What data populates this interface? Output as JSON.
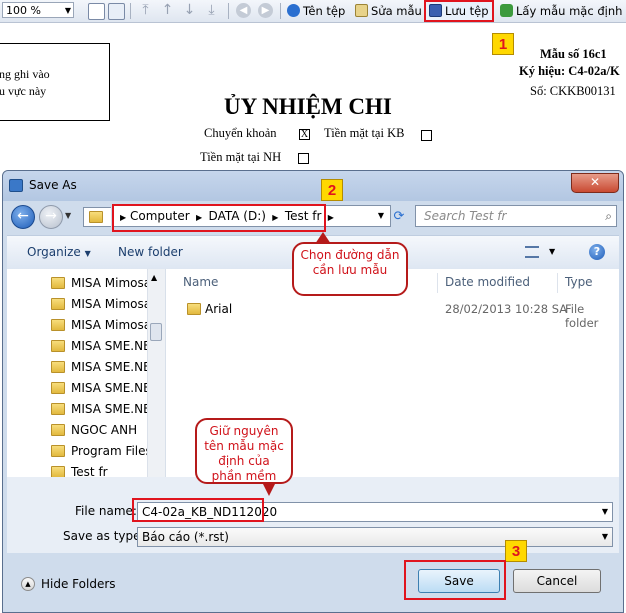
{
  "toolbar": {
    "zoom": "100 %",
    "ten_tep": "Tên tệp",
    "sua_mau": "Sửa mẫu",
    "luu_tep": "Lưu tệp",
    "lay_mau": "Lấy mẫu mặc định"
  },
  "steps": [
    "1",
    "2",
    "3"
  ],
  "document": {
    "box_line1": "ng ghi vào",
    "box_line2": "u vực này",
    "form_no": "Mẫu số 16c1",
    "code": "Ký hiệu: C4-02a/K",
    "number": "Số: CKKB00131",
    "title": "ỦY NHIỆM CHI",
    "chuyen_khoan": "Chuyển khoản",
    "chuyen_khoan_mark": "X",
    "tien_mat_kb": "Tiền mặt tại KB",
    "tien_mat_nh": "Tiền mặt tại NH"
  },
  "dialog": {
    "title": "Save As",
    "close": "✕",
    "breadcrumb": [
      "Computer",
      "DATA (D:)",
      "Test fr"
    ],
    "search_placeholder": "Search Test fr",
    "organize": "Organize",
    "new_folder": "New folder",
    "nav_items": [
      "MISA Mimosa",
      "MISA Mimosa",
      "MISA Mimosa",
      "MISA SME.NET",
      "MISA SME.NET",
      "MISA SME.NET",
      "MISA SME.NET",
      "NGOC ANH",
      "Program Files",
      "Test fr"
    ],
    "columns": {
      "name": "Name",
      "date": "Date modified",
      "type": "Type"
    },
    "files": [
      {
        "name": "Arial",
        "date": "28/02/2013 10:28 SA",
        "type": "File folder"
      }
    ],
    "file_name_label": "File name:",
    "file_name_value": "C4-02a_KB_ND112020",
    "save_type_label": "Save as type:",
    "save_type_value": "Báo cáo (*.rst)",
    "hide_folders": "Hide Folders",
    "save": "Save",
    "cancel": "Cancel"
  },
  "callouts": {
    "path": "Chọn đường dẫn cần lưu mẫu",
    "keep_name": "Giữ nguyên tên mẫu mặc định của phần mềm"
  },
  "colors": {
    "highlight": "#e0141e",
    "badge": "#ffd800",
    "callout_text": "#d0121a"
  }
}
